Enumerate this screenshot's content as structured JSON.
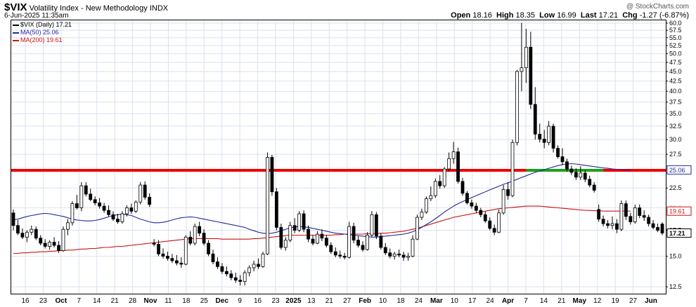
{
  "header": {
    "symbol": "$VIX",
    "name": "Volatility Index - New Methodology",
    "exchange": "INDX",
    "datetime": "6-Jun-2025 11:35am",
    "watermark": "@ StockCharts.com",
    "quote": {
      "open_label": "Open",
      "open": "18.16",
      "high_label": "High",
      "high": "18.35",
      "low_label": "Low",
      "low": "16.99",
      "last_label": "Last",
      "last": "17.21",
      "chg_label": "Chg",
      "chg": "-1.27 (-6.87%)"
    }
  },
  "legend": {
    "main": "$VIX (Daily) 17.21",
    "ma50": "MA(50) 25.06",
    "ma200": "MA(200) 19.61"
  },
  "colors": {
    "ma50": "#1f2a9c",
    "ma200": "#cc1111",
    "resistance": "#ee0000",
    "highlight": "#1aa31a",
    "grid": "#d9e2ee",
    "candle": "#000000",
    "plot_bg": "#ffffff"
  },
  "chart_data": {
    "type": "candlestick",
    "y_scale": "log",
    "ylim": [
      12.0,
      61.0
    ],
    "y_ticks": [
      "12.5",
      "15.0",
      "17.5",
      "19.61",
      "20.0",
      "22.5",
      "25.06",
      "25.0",
      "27.5",
      "30.0",
      "32.5",
      "35.0",
      "37.5",
      "40.0",
      "42.5",
      "45.0",
      "47.5",
      "50.0",
      "52.5",
      "55.0",
      "57.5",
      "60.0"
    ],
    "x_ticks": [
      "16",
      "23",
      "Oct",
      "7",
      "14",
      "21",
      "28",
      "Nov",
      "11",
      "18",
      "25",
      "Dec",
      "9",
      "16",
      "23",
      "2025",
      "13",
      "21",
      "27",
      "Feb",
      "10",
      "18",
      "24",
      "Mar",
      "10",
      "17",
      "24",
      "Apr",
      "7",
      "14",
      "21",
      "May",
      "12",
      "19",
      "27",
      "Jun"
    ],
    "bold_x_ticks": [
      "Oct",
      "Nov",
      "Dec",
      "2025",
      "Feb",
      "Mar",
      "Apr",
      "May",
      "Jun"
    ],
    "last_value": "17.21",
    "ma50_last": "25.06",
    "ma200_last": "19.61",
    "resistance_level": 25.0,
    "resistance_highlight_range": [
      "Apr 4",
      "May 12"
    ],
    "ohlc": [
      [
        19.4,
        19.8,
        17.5,
        18.0
      ],
      [
        18.0,
        18.6,
        17.0,
        17.2
      ],
      [
        17.2,
        17.7,
        16.6,
        16.8
      ],
      [
        16.8,
        17.5,
        16.3,
        17.3
      ],
      [
        17.3,
        18.0,
        17.0,
        17.6
      ],
      [
        17.6,
        17.9,
        16.5,
        16.7
      ],
      [
        16.7,
        17.0,
        16.0,
        16.2
      ],
      [
        16.2,
        16.6,
        15.7,
        15.9
      ],
      [
        15.9,
        16.5,
        15.6,
        16.3
      ],
      [
        16.3,
        16.8,
        15.8,
        16.0
      ],
      [
        16.0,
        16.4,
        15.3,
        15.5
      ],
      [
        15.5,
        17.9,
        15.4,
        17.6
      ],
      [
        17.6,
        18.7,
        17.0,
        18.3
      ],
      [
        18.3,
        20.8,
        18.0,
        20.5
      ],
      [
        20.5,
        21.6,
        19.8,
        20.0
      ],
      [
        20.0,
        23.3,
        19.6,
        22.8
      ],
      [
        22.8,
        23.3,
        21.4,
        21.7
      ],
      [
        21.7,
        22.4,
        20.8,
        21.0
      ],
      [
        21.0,
        21.4,
        20.3,
        20.6
      ],
      [
        20.6,
        21.2,
        19.9,
        20.2
      ],
      [
        20.2,
        20.6,
        19.4,
        19.7
      ],
      [
        19.7,
        20.3,
        19.0,
        19.2
      ],
      [
        19.2,
        19.6,
        18.5,
        18.7
      ],
      [
        18.7,
        19.3,
        18.2,
        18.4
      ],
      [
        18.4,
        19.6,
        18.2,
        19.3
      ],
      [
        19.3,
        20.3,
        19.0,
        20.0
      ],
      [
        20.0,
        20.5,
        19.3,
        19.6
      ],
      [
        19.6,
        20.9,
        19.4,
        20.7
      ],
      [
        20.7,
        23.3,
        20.4,
        22.9
      ],
      [
        22.9,
        23.4,
        21.0,
        21.3
      ],
      [
        21.3,
        21.8,
        20.1,
        20.4
      ],
      [
        16.2,
        16.6,
        15.9,
        16.1
      ],
      [
        16.1,
        16.5,
        15.0,
        15.2
      ],
      [
        15.2,
        15.7,
        14.8,
        15.0
      ],
      [
        15.0,
        15.4,
        14.6,
        14.8
      ],
      [
        14.8,
        15.2,
        14.4,
        14.6
      ],
      [
        14.6,
        15.1,
        14.2,
        14.4
      ],
      [
        14.4,
        14.9,
        14.0,
        14.3
      ],
      [
        14.3,
        17.0,
        14.2,
        16.8
      ],
      [
        16.8,
        17.4,
        16.0,
        16.2
      ],
      [
        16.2,
        18.2,
        16.0,
        17.9
      ],
      [
        17.9,
        18.4,
        16.9,
        17.2
      ],
      [
        17.2,
        17.6,
        16.0,
        16.2
      ],
      [
        16.2,
        16.5,
        15.0,
        15.2
      ],
      [
        15.2,
        15.6,
        14.3,
        14.5
      ],
      [
        14.5,
        14.9,
        13.9,
        14.1
      ],
      [
        14.1,
        14.4,
        13.5,
        13.7
      ],
      [
        13.7,
        14.1,
        13.3,
        13.5
      ],
      [
        13.5,
        13.8,
        13.0,
        13.2
      ],
      [
        13.2,
        13.6,
        12.8,
        13.0
      ],
      [
        13.0,
        13.4,
        12.6,
        12.9
      ],
      [
        12.9,
        13.8,
        12.6,
        13.6
      ],
      [
        13.6,
        14.2,
        13.3,
        14.0
      ],
      [
        14.0,
        14.6,
        13.7,
        14.3
      ],
      [
        14.3,
        14.8,
        13.9,
        14.1
      ],
      [
        14.1,
        15.4,
        14.0,
        15.2
      ],
      [
        15.2,
        27.8,
        15.1,
        27.0
      ],
      [
        27.0,
        27.4,
        21.5,
        22.0
      ],
      [
        22.0,
        22.5,
        17.5,
        17.8
      ],
      [
        17.8,
        18.2,
        15.6,
        15.8
      ],
      [
        15.8,
        16.8,
        15.5,
        16.5
      ],
      [
        16.5,
        18.4,
        16.3,
        18.0
      ],
      [
        18.0,
        18.8,
        17.2,
        17.5
      ],
      [
        17.5,
        19.6,
        17.3,
        19.3
      ],
      [
        19.3,
        19.7,
        17.3,
        17.6
      ],
      [
        17.6,
        18.0,
        16.3,
        16.6
      ],
      [
        16.6,
        17.0,
        16.0,
        16.2
      ],
      [
        16.2,
        17.4,
        16.1,
        17.1
      ],
      [
        17.1,
        17.6,
        16.4,
        16.7
      ],
      [
        16.7,
        17.0,
        15.8,
        16.0
      ],
      [
        16.0,
        16.3,
        15.2,
        15.4
      ],
      [
        15.4,
        15.8,
        14.9,
        15.1
      ],
      [
        15.1,
        15.5,
        14.8,
        15.0
      ],
      [
        15.0,
        15.3,
        14.7,
        14.9
      ],
      [
        14.9,
        18.4,
        14.8,
        17.9
      ],
      [
        17.9,
        18.3,
        16.2,
        16.5
      ],
      [
        16.5,
        16.9,
        15.8,
        16.0
      ],
      [
        16.0,
        16.4,
        15.4,
        15.6
      ],
      [
        15.6,
        17.3,
        15.5,
        17.0
      ],
      [
        17.0,
        19.6,
        16.8,
        19.2
      ],
      [
        19.2,
        19.5,
        16.6,
        16.9
      ],
      [
        16.9,
        17.2,
        15.6,
        15.8
      ],
      [
        15.8,
        16.2,
        15.1,
        15.3
      ],
      [
        15.3,
        15.7,
        14.8,
        15.0
      ],
      [
        15.0,
        15.4,
        14.7,
        15.2
      ],
      [
        15.2,
        15.6,
        14.9,
        15.1
      ],
      [
        15.1,
        15.4,
        14.6,
        14.9
      ],
      [
        14.9,
        15.3,
        14.6,
        15.0
      ],
      [
        15.0,
        17.0,
        14.9,
        16.6
      ],
      [
        16.6,
        19.2,
        16.5,
        18.9
      ],
      [
        18.9,
        19.9,
        18.6,
        19.5
      ],
      [
        19.5,
        21.4,
        19.3,
        21.1
      ],
      [
        21.1,
        22.7,
        20.8,
        21.5
      ],
      [
        21.5,
        23.8,
        21.2,
        23.4
      ],
      [
        23.4,
        24.3,
        22.4,
        22.8
      ],
      [
        22.8,
        25.5,
        22.5,
        25.2
      ],
      [
        25.2,
        27.8,
        24.8,
        26.8
      ],
      [
        26.8,
        29.6,
        26.0,
        27.9
      ],
      [
        27.9,
        28.6,
        23.1,
        23.4
      ],
      [
        23.4,
        23.9,
        21.5,
        21.8
      ],
      [
        21.8,
        22.1,
        20.4,
        20.6
      ],
      [
        20.6,
        21.0,
        19.9,
        20.2
      ],
      [
        20.2,
        20.6,
        19.4,
        19.7
      ],
      [
        19.7,
        20.0,
        18.9,
        19.2
      ],
      [
        19.2,
        19.6,
        18.3,
        18.5
      ],
      [
        18.5,
        18.9,
        17.5,
        17.7
      ],
      [
        17.7,
        18.1,
        17.0,
        17.3
      ],
      [
        17.3,
        19.8,
        17.2,
        19.4
      ],
      [
        19.4,
        22.9,
        19.2,
        22.3
      ],
      [
        22.3,
        23.3,
        21.0,
        21.5
      ],
      [
        21.5,
        30.0,
        21.3,
        29.5
      ],
      [
        29.5,
        45.4,
        29.0,
        45.0
      ],
      [
        45.0,
        60.1,
        40.0,
        46.0
      ],
      [
        46.0,
        58.0,
        42.0,
        52.0
      ],
      [
        52.0,
        57.0,
        36.0,
        37.0
      ],
      [
        37.0,
        41.0,
        30.0,
        31.0
      ],
      [
        31.0,
        33.0,
        29.5,
        30.1
      ],
      [
        30.1,
        31.8,
        28.5,
        29.5
      ],
      [
        29.5,
        33.5,
        29.0,
        32.5
      ],
      [
        32.5,
        33.0,
        27.8,
        28.5
      ],
      [
        28.5,
        29.0,
        26.8,
        27.1
      ],
      [
        27.1,
        28.5,
        25.8,
        26.3
      ],
      [
        26.3,
        26.8,
        24.8,
        25.2
      ],
      [
        25.2,
        25.7,
        24.3,
        24.7
      ],
      [
        24.7,
        25.3,
        23.6,
        24.0
      ],
      [
        24.0,
        25.6,
        23.6,
        24.6
      ],
      [
        24.6,
        25.0,
        23.3,
        23.7
      ],
      [
        23.7,
        24.2,
        22.6,
        22.9
      ],
      [
        22.9,
        23.3,
        21.9,
        22.2
      ],
      [
        19.8,
        20.4,
        18.4,
        18.7
      ],
      [
        18.7,
        19.1,
        17.9,
        18.2
      ],
      [
        18.2,
        18.6,
        17.7,
        18.0
      ],
      [
        18.0,
        19.0,
        17.6,
        18.2
      ],
      [
        18.2,
        18.7,
        17.2,
        17.6
      ],
      [
        17.6,
        20.9,
        17.4,
        20.5
      ],
      [
        20.5,
        20.9,
        18.6,
        19.0
      ],
      [
        19.0,
        19.4,
        18.1,
        18.4
      ],
      [
        18.4,
        20.4,
        18.2,
        20.0
      ],
      [
        20.0,
        20.4,
        18.8,
        19.1
      ],
      [
        19.1,
        19.7,
        18.5,
        18.9
      ],
      [
        18.9,
        19.2,
        17.9,
        18.2
      ],
      [
        18.2,
        18.6,
        17.6,
        17.8
      ],
      [
        17.8,
        18.2,
        17.3,
        17.5
      ],
      [
        18.16,
        18.35,
        16.99,
        17.21
      ]
    ],
    "ma50": [
      18.6,
      18.7,
      18.85,
      19.0,
      19.1,
      19.2,
      19.3,
      19.35,
      19.3,
      19.2,
      19.1,
      19.0,
      18.85,
      18.7,
      18.6,
      18.55,
      18.5,
      18.5,
      18.55,
      18.65,
      18.8,
      18.95,
      19.1,
      19.2,
      19.25,
      19.2,
      19.1,
      18.9,
      18.7,
      18.55,
      18.4,
      18.3,
      18.3,
      18.35,
      18.45,
      18.6,
      18.75,
      18.85,
      18.9,
      18.95,
      18.9,
      18.8,
      18.7,
      18.6,
      18.5,
      18.4,
      18.3,
      18.2,
      18.1,
      18.0,
      17.9,
      17.8,
      17.6,
      17.45,
      17.3,
      17.2,
      17.15,
      17.2,
      17.3,
      17.45,
      17.6,
      17.75,
      17.85,
      17.9,
      17.85,
      17.8,
      17.7,
      17.6,
      17.5,
      17.4,
      17.3,
      17.2,
      17.15,
      17.1,
      17.05,
      17.0,
      16.95,
      16.9,
      16.85,
      16.8,
      16.8,
      16.85,
      16.9,
      16.95,
      17.0,
      17.05,
      17.1,
      17.2,
      17.35,
      17.55,
      17.8,
      18.1,
      18.4,
      18.75,
      19.1,
      19.5,
      19.85,
      20.2,
      20.5,
      20.75,
      21.0,
      21.25,
      21.5,
      21.75,
      22.0,
      22.25,
      22.5,
      22.75,
      23.0,
      23.2,
      23.45,
      23.7,
      23.95,
      24.2,
      24.45,
      24.7,
      24.9,
      25.1,
      25.3,
      25.5,
      25.7,
      25.85,
      25.95,
      26.0,
      25.95,
      25.85,
      25.75,
      25.65,
      25.55,
      25.45,
      25.35,
      25.3,
      25.2,
      25.15,
      25.1,
      25.08,
      25.06
    ],
    "ma200": [
      15.25,
      15.25,
      15.3,
      15.3,
      15.35,
      15.35,
      15.4,
      15.4,
      15.45,
      15.45,
      15.5,
      15.5,
      15.55,
      15.55,
      15.6,
      15.65,
      15.65,
      15.7,
      15.7,
      15.75,
      15.8,
      15.8,
      15.85,
      15.9,
      15.9,
      15.95,
      16.0,
      16.05,
      16.1,
      16.15,
      16.2,
      16.25,
      16.3,
      16.35,
      16.4,
      16.45,
      16.5,
      16.55,
      16.6,
      16.65,
      16.65,
      16.65,
      16.65,
      16.65,
      16.65,
      16.65,
      16.6,
      16.6,
      16.6,
      16.6,
      16.6,
      16.6,
      16.6,
      16.65,
      16.65,
      16.7,
      16.75,
      16.8,
      16.85,
      16.9,
      16.95,
      17.0,
      17.0,
      17.0,
      17.0,
      17.0,
      17.0,
      17.0,
      17.0,
      17.0,
      17.0,
      17.05,
      17.05,
      17.1,
      17.1,
      17.1,
      17.1,
      17.1,
      17.15,
      17.15,
      17.15,
      17.2,
      17.2,
      17.25,
      17.3,
      17.35,
      17.4,
      17.5,
      17.6,
      17.7,
      17.85,
      18.0,
      18.15,
      18.3,
      18.45,
      18.6,
      18.75,
      18.9,
      19.0,
      19.1,
      19.2,
      19.3,
      19.4,
      19.5,
      19.6,
      19.7,
      19.8,
      19.9,
      19.95,
      20.0,
      20.05,
      20.1,
      20.15,
      20.2,
      20.2,
      20.2,
      20.2,
      20.15,
      20.1,
      20.05,
      20.0,
      19.95,
      19.9,
      19.85,
      19.8,
      19.75,
      19.7,
      19.68,
      19.66,
      19.64,
      19.62,
      19.61,
      19.61,
      19.61,
      19.61,
      19.61,
      19.61
    ]
  }
}
